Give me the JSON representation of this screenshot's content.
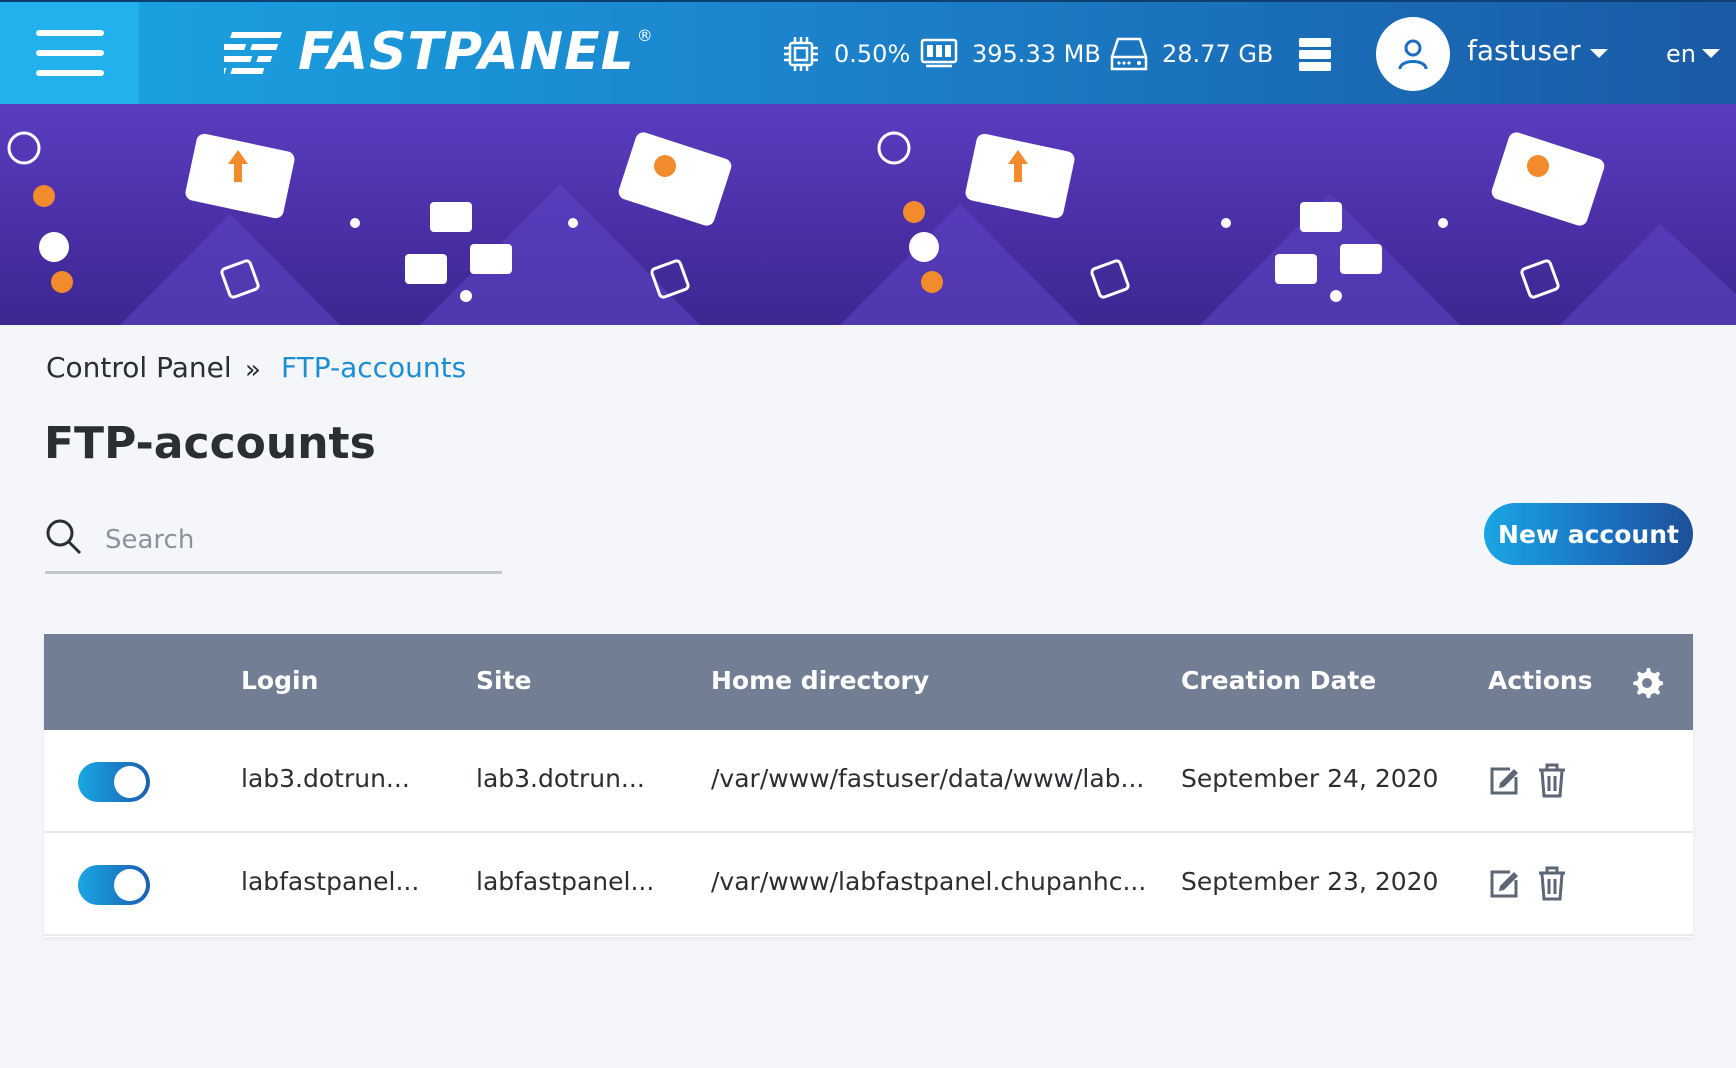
{
  "header": {
    "brand": "FASTPANEL",
    "brand_mark": "®",
    "cpu": "0.50%",
    "memory": "395.33 MB",
    "disk": "28.77 GB",
    "username": "fastuser",
    "language": "en"
  },
  "breadcrumb": {
    "root": "Control Panel",
    "separator": "»",
    "current": "FTP-accounts"
  },
  "page": {
    "title": "FTP-accounts"
  },
  "search": {
    "placeholder": "Search"
  },
  "actions": {
    "new_account": "New account"
  },
  "table": {
    "columns": {
      "login": "Login",
      "site": "Site",
      "home": "Home directory",
      "created": "Creation Date",
      "actions": "Actions"
    },
    "rows": [
      {
        "enabled": true,
        "login": "lab3.dotrun...",
        "site": "lab3.dotrun...",
        "home": "/var/www/fastuser/data/www/lab...",
        "created": "September 24, 2020"
      },
      {
        "enabled": true,
        "login": "labfastpanel...",
        "site": "labfastpanel...",
        "home": "/var/www/labfastpanel.chupanhc...",
        "created": "September 23, 2020"
      }
    ]
  },
  "colors": {
    "accent": "#1b8fd1",
    "header_start": "#1aa6e4",
    "header_end": "#1a5aa6",
    "table_head": "#717e94",
    "banner": "#4a2fa6"
  },
  "icons": {
    "menu": "hamburger-icon",
    "cpu": "cpu-chip-icon",
    "memory": "memory-icon",
    "disk": "hard-drive-icon",
    "servers": "server-stack-icon",
    "user": "user-icon",
    "search": "search-icon",
    "settings": "gear-icon",
    "edit": "edit-icon",
    "delete": "trash-icon"
  }
}
